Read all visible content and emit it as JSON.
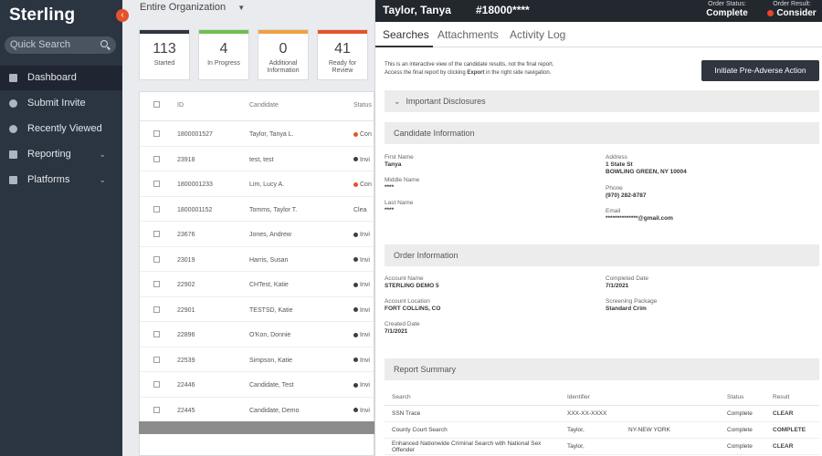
{
  "sidebar": {
    "logo": "Sterling",
    "quick_search_placeholder": "Quick Search",
    "nav": [
      {
        "label": "Dashboard",
        "icon": "grid-icon",
        "active": true
      },
      {
        "label": "Submit Invite",
        "icon": "plus-circle-icon"
      },
      {
        "label": "Recently Viewed",
        "icon": "clock-icon"
      },
      {
        "label": "Reporting",
        "icon": "chart-icon"
      },
      {
        "label": "Platforms",
        "icon": "external-link-icon"
      }
    ]
  },
  "main": {
    "org_select": "Entire Organization",
    "cards": [
      {
        "value": "113",
        "label": "Started",
        "color": "#2f3640"
      },
      {
        "value": "4",
        "label": "In Progress",
        "color": "#6fbf4f"
      },
      {
        "value": "0",
        "label": "Additional Information",
        "color": "#f0a041"
      },
      {
        "value": "41",
        "label": "Ready for Review",
        "color": "#e5532b"
      }
    ],
    "table": {
      "headers": {
        "id": "ID",
        "candidate": "Candidate",
        "status": "Status"
      },
      "rows": [
        {
          "id": "1800001527",
          "name": "Taylor, Tanya L.",
          "status": "Con",
          "dot": "#e5532b"
        },
        {
          "id": "23918",
          "name": "test, test",
          "status": "Invi",
          "dot": "#3a3f47"
        },
        {
          "id": "1800001233",
          "name": "Lim, Lucy A.",
          "status": "Con",
          "dot": "#e5532b"
        },
        {
          "id": "1800001152",
          "name": "Tomms, Taylor T.",
          "status": "Clea",
          "dot": ""
        },
        {
          "id": "23676",
          "name": "Jones, Andrew",
          "status": "Invi",
          "dot": "#3a3f47"
        },
        {
          "id": "23019",
          "name": "Harris, Susan",
          "status": "Invi",
          "dot": "#3a3f47"
        },
        {
          "id": "22902",
          "name": "CHTest, Katie",
          "status": "Invi",
          "dot": "#3a3f47"
        },
        {
          "id": "22901",
          "name": "TESTSD, Katie",
          "status": "Invi",
          "dot": "#3a3f47"
        },
        {
          "id": "22896",
          "name": "O'Kon, Donnie",
          "status": "Invi",
          "dot": "#3a3f47"
        },
        {
          "id": "22539",
          "name": "Simpson, Katie",
          "status": "Invi",
          "dot": "#3a3f47"
        },
        {
          "id": "22446",
          "name": "Candidate, Test",
          "status": "Invi",
          "dot": "#3a3f47"
        },
        {
          "id": "22445",
          "name": "Candidate, Demo",
          "status": "Invi",
          "dot": "#3a3f47"
        }
      ]
    }
  },
  "panel": {
    "candidate_name": "Taylor, Tanya",
    "order_number": "#18000****",
    "order_status_label": "Order Status:",
    "order_status": "Complete",
    "order_result_label": "Order Result:",
    "order_result": "Consider",
    "tabs": [
      "Searches",
      "Attachments",
      "Activity Log"
    ],
    "notice_line1": "This is an interactive view of the candidate results, not the final report.",
    "notice_line2a": "Access the final report by clicking ",
    "notice_export": "Export",
    "notice_line2b": " in the right side navigation.",
    "pre_adverse_button": "Initiate Pre-Adverse Action",
    "important_disclosures": "Important Disclosures",
    "candidate_info": {
      "title": "Candidate Information",
      "first_name_label": "First Name",
      "first_name": "Tanya",
      "middle_name_label": "Middle Name",
      "middle_name": "****",
      "last_name_label": "Last Name",
      "last_name": "****",
      "address_label": "Address",
      "address1": "1 State St",
      "address2": "BOWLING GREEN, NY 10004",
      "phone_label": "Phone",
      "phone": "(970) 282-8787",
      "email_label": "Email",
      "email": "**************@gmail.com"
    },
    "order_info": {
      "title": "Order Information",
      "account_name_label": "Account Name",
      "account_name": "STERLING DEMO 5",
      "account_location_label": "Account Location",
      "account_location": "FORT COLLINS, CO",
      "created_date_label": "Created Date",
      "created_date": "7/1/2021",
      "completed_date_label": "Completed Date",
      "completed_date": "7/1/2021",
      "screening_package_label": "Screening Package",
      "screening_package": "Standard Crim"
    },
    "report_summary": {
      "title": "Report Summary",
      "headers": {
        "search": "Search",
        "identifier": "Identifier",
        "status": "Status",
        "result": "Result"
      },
      "rows": [
        {
          "search": "SSN Trace",
          "identifier": "XXX-XX-XXXX",
          "extra": "",
          "status": "Complete",
          "result": "CLEAR"
        },
        {
          "search": "County Court Search",
          "identifier": "Taylor,",
          "extra": "NY-NEW YORK",
          "status": "Complete",
          "result": "COMPLETE"
        },
        {
          "search": "Enhanced Nationwide Criminal Search with National Sex Offender",
          "identifier": "Taylor,",
          "extra": "",
          "status": "Complete",
          "result": "CLEAR"
        }
      ]
    }
  }
}
